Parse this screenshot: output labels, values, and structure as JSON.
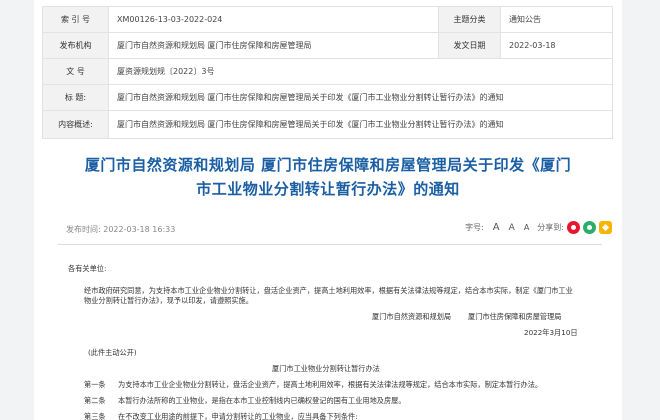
{
  "meta": {
    "row1": {
      "label_a": "索 引 号",
      "value_a": "XM00126-13-03-2022-024",
      "label_b": "主题分类",
      "value_b": "通知公告"
    },
    "row2": {
      "label_a": "发布机构",
      "value_a": "厦门市自然资源和规划局 厦门市住房保障和房屋管理局",
      "label_b": "发文日期",
      "value_b": "2022-03-18"
    },
    "row3": {
      "label": "文 号",
      "value": "厦资源规划规〔2022〕3号"
    },
    "row4": {
      "label": "标 题:",
      "value": "厦门市自然资源和规划局 厦门市住房保障和房屋管理局关于印发《厦门市工业物业分割转让暂行办法》的通知"
    },
    "row5": {
      "label": "内容概述:",
      "value": "厦门市自然资源和规划局 厦门市住房保障和房屋管理局关于印发《厦门市工业物业分割转让暂行办法》的通知"
    }
  },
  "article": {
    "title_line1": "厦门市自然资源和规划局 厦门市住房保障和房屋管理局关于印发《厦门",
    "title_line2": "市工业物业分割转让暂行办法》的通知",
    "publish_time": "发布时间: 2022-03-18 16:33",
    "font_size_label": "字号:",
    "font_large": "A",
    "font_medium": "A",
    "font_small": "A",
    "share_label": "分享到:"
  },
  "content": {
    "salutation": "各有关单位:",
    "para1_line1": "经市政府研究同意，为支持本市工业企业物业分割转让，盘活企业资产，提高土地利用效率，根据有关法律法规等规定，结合本市实际，制定《厦门市工业",
    "para1_line2": "物业分割转让暂行办法》，现予以印发，请遵照实施。",
    "sign_org1": "厦门市自然资源和规划局",
    "sign_org2": "厦门市住房保障和房屋管理局",
    "sign_date": "2022年3月10日",
    "public_note": "(此件主动公开)",
    "doc_title": "厦门市工业物业分割转让暂行办法",
    "art1_label": "第一条",
    "art1_text": "为支持本市工业企业物业分割转让，盘活企业资产，提高土地利用效率，根据有关法律法规等规定，结合本市实际，制定本暂行办法。",
    "art2_label": "第二条",
    "art2_text": "本暂行办法所称的工业物业，是指在本市工业控制线内已确权登记的国有工业用地及房屋。",
    "art3_label": "第三条",
    "art3_text": "在不改变工业用途的前提下，申请分割转让的工业物业，应当具备下列条件:"
  }
}
